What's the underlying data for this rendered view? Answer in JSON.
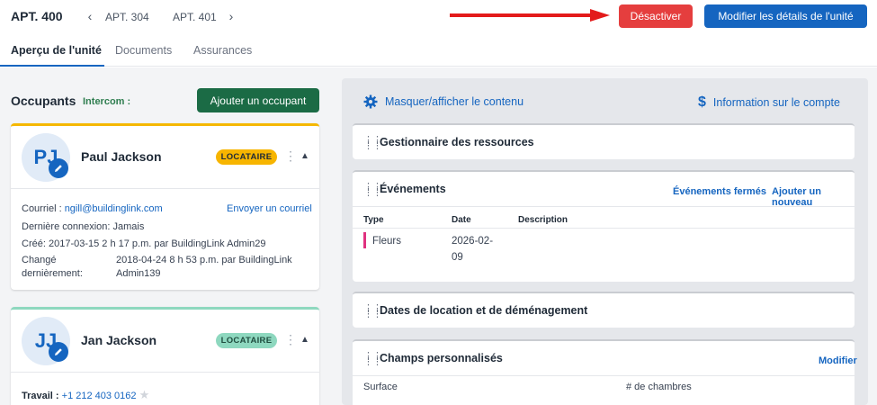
{
  "header": {
    "unit_title": "APT. 400",
    "prev_unit": "APT. 304",
    "next_unit": "APT. 401",
    "deactivate_label": "Désactiver",
    "modify_label": "Modifier les détails de l'unité"
  },
  "tabs": [
    {
      "label": "Aperçu de l'unité",
      "active": true
    },
    {
      "label": "Documents",
      "active": false
    },
    {
      "label": "Assurances",
      "active": false
    }
  ],
  "occupants": {
    "title": "Occupants",
    "intercom_label": "Intercom :",
    "add_button": "Ajouter un occupant",
    "people": [
      {
        "initials": "PJ",
        "name": "Paul Jackson",
        "badge": "LOCATAIRE",
        "badge_color": "#f7b500",
        "email_label": "Courriel :",
        "email": "ngill@buildinglink.com",
        "send_email": "Envoyer un courriel",
        "last_login_label": "Dernière connexion:",
        "last_login": "Jamais",
        "created_label": "Créé:",
        "created": "2017-03-15 2 h 17 p.m. par BuildingLink Admin29",
        "changed_label_1": "Changé",
        "changed_label_2": "dernièrement:",
        "changed_1": "2018-04-24 8 h 53 p.m. par BuildingLink",
        "changed_2": "Admin139"
      },
      {
        "initials": "JJ",
        "name": "Jan Jackson",
        "badge": "LOCATAIRE",
        "badge_color": "#8ed8bf",
        "work_label": "Travail :",
        "work_phone": "+1 212 403 0162"
      }
    ]
  },
  "right": {
    "toggle_content": "Masquer/afficher le contenu",
    "account_info": "Information sur le compte",
    "sections": {
      "resources": {
        "title": "Gestionnaire des ressources"
      },
      "events": {
        "title": "Événements",
        "closed_link": "Événements fermés",
        "add_link": "Ajouter un nouveau",
        "columns": [
          "Type",
          "Date",
          "Description"
        ],
        "rows": [
          {
            "type": "Fleurs",
            "date_1": "2026-02-",
            "date_2": "09",
            "description": ""
          }
        ]
      },
      "rental": {
        "title": "Dates de location et de déménagement"
      },
      "custom": {
        "title": "Champs personnalisés",
        "modify_link": "Modifier",
        "fields": [
          "Surface",
          "# de chambres"
        ]
      }
    }
  },
  "colors": {
    "primary": "#1565c0",
    "danger": "#e53e3e",
    "success": "#1b6b45",
    "tenant_yellow": "#f7b500",
    "tenant_green": "#8ed8bf",
    "event_marker": "#e0317f"
  }
}
